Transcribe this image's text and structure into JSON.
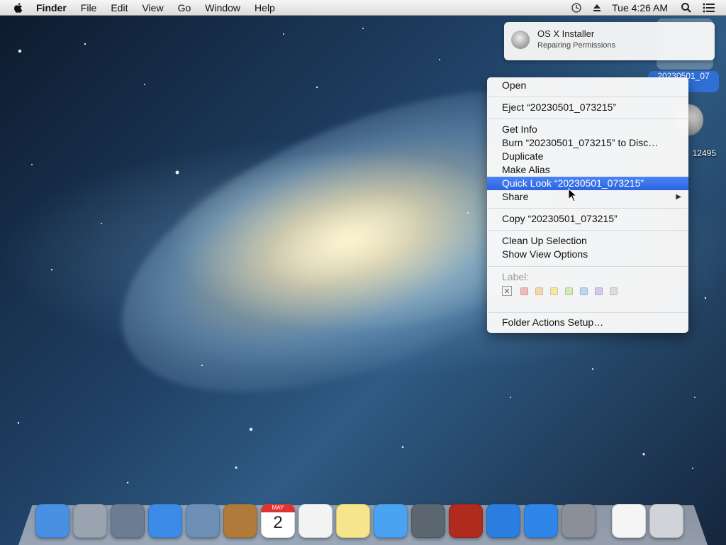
{
  "menubar": {
    "app": "Finder",
    "items": [
      "File",
      "Edit",
      "View",
      "Go",
      "Window",
      "Help"
    ],
    "clock": "Tue 4:26 AM"
  },
  "notification": {
    "title": "OS X Installer",
    "subtitle": "Repairing Permissions"
  },
  "desktop": {
    "selected_disk_label": "20230501_07\n15",
    "second_disk_label": "12495"
  },
  "context_menu": {
    "items": [
      {
        "label": "Open"
      },
      {
        "label": "Eject “20230501_073215”"
      },
      {
        "label": "Get Info"
      },
      {
        "label": "Burn “20230501_073215” to Disc…"
      },
      {
        "label": "Duplicate"
      },
      {
        "label": "Make Alias"
      },
      {
        "label": "Quick Look “20230501_073215”",
        "selected": true
      },
      {
        "label": "Share",
        "submenu": true
      },
      {
        "label": "Copy “20230501_073215”"
      },
      {
        "label": "Clean Up Selection"
      },
      {
        "label": "Show View Options"
      },
      {
        "label": "Folder Actions Setup…"
      }
    ],
    "label_heading": "Label:",
    "label_colors": [
      "#f2b9b9",
      "#f6d7ad",
      "#f3eaa7",
      "#d2e9b8",
      "#bcd6f2",
      "#d8c6ee",
      "#dcdcdc"
    ]
  },
  "dock": {
    "apps": [
      {
        "name": "finder-icon",
        "color": "#4a90e2"
      },
      {
        "name": "launchpad-icon",
        "color": "#9aa4b0"
      },
      {
        "name": "mission-control-icon",
        "color": "#6b7d92"
      },
      {
        "name": "safari-icon",
        "color": "#3c8be6"
      },
      {
        "name": "mail-icon",
        "color": "#6d8fb5"
      },
      {
        "name": "contacts-icon",
        "color": "#b07a3a"
      },
      {
        "name": "calendar-icon",
        "color": "#ffffff"
      },
      {
        "name": "reminders-icon",
        "color": "#f3f3f3"
      },
      {
        "name": "notes-icon",
        "color": "#f6e58b"
      },
      {
        "name": "messages-icon",
        "color": "#4aa3f0"
      },
      {
        "name": "facetime-icon",
        "color": "#5b6670"
      },
      {
        "name": "photo-booth-icon",
        "color": "#b02a1e"
      },
      {
        "name": "itunes-icon",
        "color": "#2b7de0"
      },
      {
        "name": "app-store-icon",
        "color": "#2f86e8"
      },
      {
        "name": "system-preferences-icon",
        "color": "#8a8f98"
      }
    ],
    "docs": [
      {
        "name": "document-icon",
        "color": "#f5f5f5"
      },
      {
        "name": "trash-icon",
        "color": "#d0d4d8"
      }
    ],
    "calendar": {
      "month": "MAY",
      "day": "2"
    }
  }
}
